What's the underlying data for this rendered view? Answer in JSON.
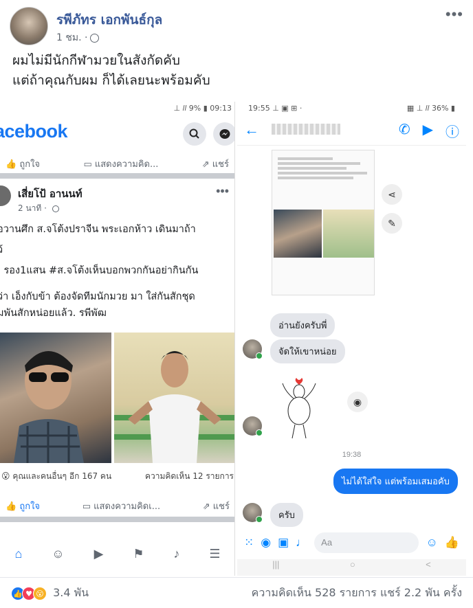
{
  "post": {
    "author": "รพีภัทร เอกพันธ์กุล",
    "time": "1 ชม. ·",
    "caption_line1": "ผมไม่มีนักกีฬามวยในสังกัดคับ",
    "caption_line2": "แต่ถ้าคุณกับผม ก็ได้เลยนะพร้อมคับ",
    "more": "•••"
  },
  "left_shot": {
    "status_bar": "⊥ 𝑙𝑙 9% ▮ 09:13",
    "logo": "acebook",
    "like": "ถูกใจ",
    "comment": "แสดงความคิด...",
    "share": "แชร์",
    "post_name": "เสี่ยโป้ อานนท์",
    "post_time": "2 นาที · ",
    "text_lines": [
      "อวานศึก ส.จโต้งปราจีน พระเอกห้าว เดินมาถ้า",
      "ว้",
      ": รอง1แสน #ส.จโต้งเห็นบอกพวกกันอย่ากินกัน",
      "ว่า เอ็งกับข้า ต้องจัดทีมนักมวย มา ใส่กันสักชุด",
      "มพันสักหน่อยแล้ว. รพีพัฒ"
    ],
    "reactions": "คุณและคนอื่นๆ อีก 167 คน",
    "comments_count": "ความคิดเห็น 12 รายการ",
    "like2": "ถูกใจ",
    "comment2": "แสดงความคิดเ...",
    "share2": "แชร์"
  },
  "right_shot": {
    "status_left": "19:55 ⊥ ▣ ⊞ ·",
    "status_right": "▦ ⊥ 𝑙𝑙 36% ▮",
    "msg1": "อ่านยังครับพี่",
    "msg2": "จัดให้เขาหน่อย",
    "timestamp": "19:38",
    "msg_out": "ไม่ได้ใส่ใจ แต่พร้อมเสมอคับ",
    "msg3": "ครับ",
    "composer_placeholder": "Aa",
    "nav_items": [
      "|||",
      "○",
      "<"
    ]
  },
  "footer": {
    "reactions_count": "3.4 พัน",
    "stats": "ความคิดเห็น 528 รายการ  แชร์ 2.2 พัน ครั้ง"
  },
  "colors": {
    "facebook_blue": "#1877f2",
    "messenger_blue": "#0084ff",
    "link": "#385898"
  }
}
